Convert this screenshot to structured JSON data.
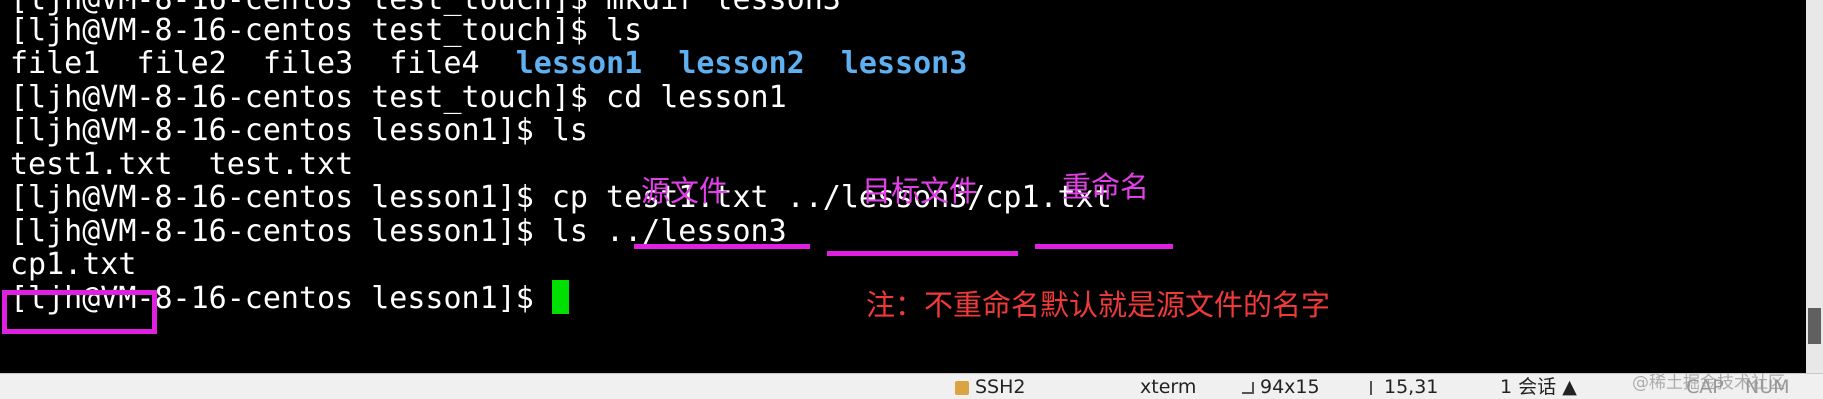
{
  "terminal": {
    "lines": [
      "[ljh@VM-8-16-centos test_touch]$ mkdir lesson3",
      "[ljh@VM-8-16-centos test_touch]$ ls",
      "",
      "[ljh@VM-8-16-centos test_touch]$ cd lesson1",
      "[ljh@VM-8-16-centos lesson1]$ ls",
      "test1.txt  test.txt",
      "[ljh@VM-8-16-centos lesson1]$ cp test1.txt ../lesson3/cp1.txt",
      "[ljh@VM-8-16-centos lesson1]$ ls ../lesson3",
      "cp1.txt",
      "[ljh@VM-8-16-centos lesson1]$ "
    ],
    "ls_files": [
      "file1",
      "file2",
      "file3",
      "file4"
    ],
    "ls_dirs": [
      "lesson1",
      "lesson2",
      "lesson3"
    ],
    "dir_color": "#5fb0f0",
    "cursor_color": "#00e000"
  },
  "annotations": {
    "source_label": "源文件",
    "target_label": "目标文件",
    "rename_label": "重命名",
    "note": "注：不重命名默认就是源文件的名字",
    "annotation_color": "#e040e6",
    "note_color": "#f03a3a"
  },
  "statusbar": {
    "connection": "SSH2",
    "terminal_type": "xterm",
    "size": "94x15",
    "position": "15,31",
    "sessions": "1 会话",
    "caps": "CAP",
    "num": "NUM"
  },
  "watermark": "@稀土掘金技术社区"
}
